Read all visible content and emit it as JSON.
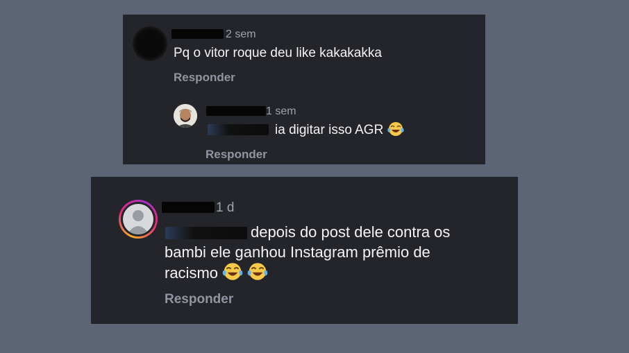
{
  "comments": [
    {
      "time": "2 sem",
      "text": "Pq o vitor roque deu like kakakakka",
      "reply_label": "Responder"
    },
    {
      "time": "1 sem",
      "text": "ia digitar isso AGR",
      "reply_label": "Responder",
      "emoji": "😂"
    },
    {
      "time": "1 d",
      "text_line1": "depois do post dele contra os",
      "text_line2": "bambi ele ganhou Instagram prêmio de",
      "text_line3": "racismo",
      "reply_label": "Responder",
      "emoji": "😂"
    }
  ],
  "colors": {
    "page_background": "#5b6575",
    "card_background": "#24252b",
    "story_ring": [
      "#f5b02b",
      "#e52b74",
      "#a92fc9"
    ]
  },
  "icons": [
    "crying-laughing-emoji",
    "default-avatar-icon"
  ]
}
